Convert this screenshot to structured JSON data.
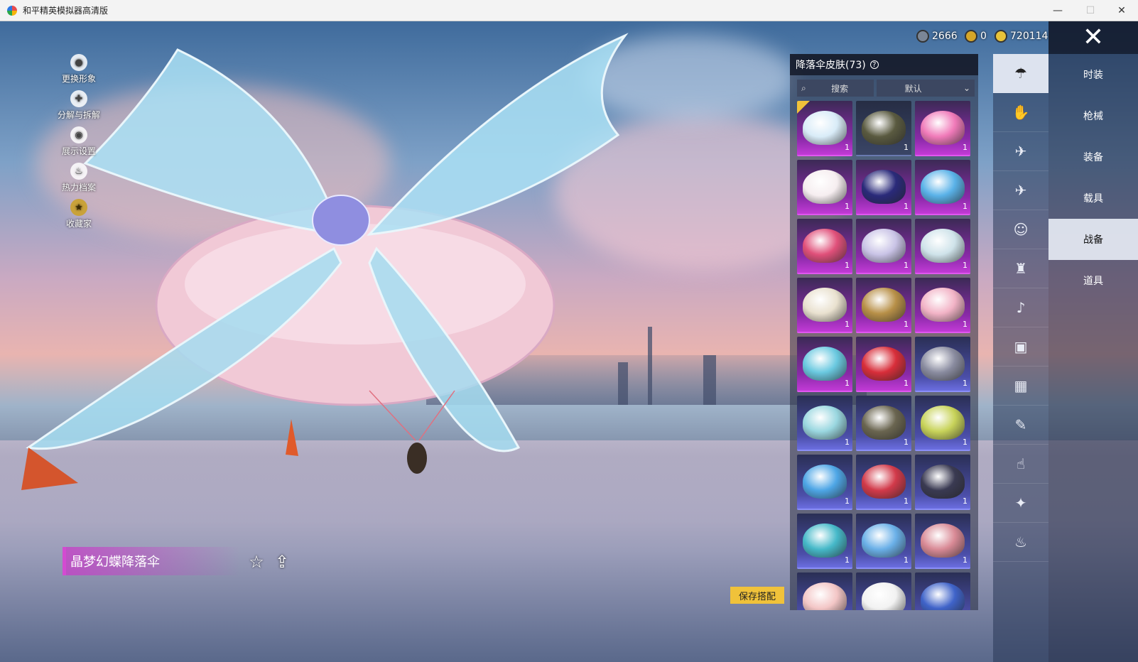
{
  "window": {
    "title": "和平精英模拟器高清版",
    "min_label": "—",
    "max_label": "☐",
    "close_label": "✕"
  },
  "left_menu": [
    {
      "label": "更换形象",
      "icon": "person-icon"
    },
    {
      "label": "分解与拆解",
      "icon": "dismantle-icon"
    },
    {
      "label": "展示设置",
      "icon": "eye-icon"
    },
    {
      "label": "热力档案",
      "icon": "flame-icon"
    },
    {
      "label": "收藏家",
      "icon": "collector-badge-icon"
    }
  ],
  "currency": [
    {
      "value": "2666",
      "icon": "coin-silver-icon",
      "color": "#7b8696"
    },
    {
      "value": "0",
      "icon": "coin-gold-a-icon",
      "color": "#d6a629"
    },
    {
      "value": "720114",
      "icon": "coin-gold-icon",
      "color": "#e8c33a"
    }
  ],
  "item": {
    "name": "晶梦幻蝶降落伞",
    "fav_icon": "☆",
    "share_icon": "⇪"
  },
  "save_button": "保存搭配",
  "panel": {
    "title": "降落伞皮肤(73)",
    "help_icon": "?",
    "search_label": "搜索",
    "search_icon": "⌕",
    "sort_label": "默认",
    "sort_icon": "⌄",
    "items": [
      {
        "count": "1",
        "rarity": "purple",
        "color": "#d9ecf8",
        "equipped": true
      },
      {
        "count": "1",
        "rarity": "dark",
        "color": "#5a5a40",
        "equipped": false
      },
      {
        "count": "1",
        "rarity": "purple",
        "color": "#f07ab9",
        "equipped": false
      },
      {
        "count": "1",
        "rarity": "purple",
        "color": "#f6eef0",
        "equipped": false
      },
      {
        "count": "1",
        "rarity": "purple",
        "color": "#2a2a7a",
        "equipped": false
      },
      {
        "count": "1",
        "rarity": "purple",
        "color": "#5ab2e8",
        "equipped": false
      },
      {
        "count": "1",
        "rarity": "purple",
        "color": "#e0507a",
        "equipped": false
      },
      {
        "count": "1",
        "rarity": "purple",
        "color": "#c9c3e6",
        "equipped": false
      },
      {
        "count": "1",
        "rarity": "purple",
        "color": "#cfe3ea",
        "equipped": false
      },
      {
        "count": "1",
        "rarity": "purple",
        "color": "#e9e1cf",
        "equipped": false
      },
      {
        "count": "1",
        "rarity": "purple",
        "color": "#b89048",
        "equipped": false
      },
      {
        "count": "1",
        "rarity": "purple",
        "color": "#f2b3c6",
        "equipped": false
      },
      {
        "count": "1",
        "rarity": "purple",
        "color": "#6ac9e0",
        "equipped": false
      },
      {
        "count": "1",
        "rarity": "purple",
        "color": "#d82e3a",
        "equipped": false
      },
      {
        "count": "1",
        "rarity": "blue",
        "color": "#8a8ca0",
        "equipped": false
      },
      {
        "count": "1",
        "rarity": "blue",
        "color": "#9ad7e0",
        "equipped": false
      },
      {
        "count": "1",
        "rarity": "blue",
        "color": "#6a6550",
        "equipped": false
      },
      {
        "count": "1",
        "rarity": "blue",
        "color": "#c8d35a",
        "equipped": false
      },
      {
        "count": "1",
        "rarity": "blue",
        "color": "#4ea6e6",
        "equipped": false
      },
      {
        "count": "1",
        "rarity": "blue",
        "color": "#d23a4a",
        "equipped": false
      },
      {
        "count": "1",
        "rarity": "blue",
        "color": "#3a3a52",
        "equipped": false
      },
      {
        "count": "1",
        "rarity": "blue",
        "color": "#46b9c9",
        "equipped": false
      },
      {
        "count": "1",
        "rarity": "blue",
        "color": "#6ab0e8",
        "equipped": false
      },
      {
        "count": "1",
        "rarity": "blue",
        "color": "#d98a96",
        "equipped": false
      },
      {
        "count": "",
        "rarity": "blue",
        "color": "#f3c6c6",
        "equipped": false
      },
      {
        "count": "",
        "rarity": "blue",
        "color": "#f2f2f2",
        "equipped": false
      },
      {
        "count": "",
        "rarity": "blue",
        "color": "#3f63c9",
        "equipped": false
      }
    ]
  },
  "icon_tabs": [
    {
      "icon": "parachute-icon",
      "glyph": "☂",
      "active": true
    },
    {
      "icon": "hand-icon",
      "glyph": "✋",
      "active": false
    },
    {
      "icon": "drone-icon",
      "glyph": "✈",
      "active": false
    },
    {
      "icon": "plane-icon",
      "glyph": "✈",
      "active": false
    },
    {
      "icon": "emote-face-icon",
      "glyph": "☺",
      "active": false
    },
    {
      "icon": "robot-icon",
      "glyph": "♜",
      "active": false
    },
    {
      "icon": "speaker-icon",
      "glyph": "♪",
      "active": false
    },
    {
      "icon": "chat-box-icon",
      "glyph": "▣",
      "active": false
    },
    {
      "icon": "picture-icon",
      "glyph": "▦",
      "active": false
    },
    {
      "icon": "spray-icon",
      "glyph": "✎",
      "active": false
    },
    {
      "icon": "gesture-icon",
      "glyph": "☝",
      "active": false
    },
    {
      "icon": "magic-wand-icon",
      "glyph": "✦",
      "active": false
    },
    {
      "icon": "food-icon",
      "glyph": "♨",
      "active": false
    }
  ],
  "categories": [
    {
      "label": "时装",
      "active": false
    },
    {
      "label": "枪械",
      "active": false
    },
    {
      "label": "装备",
      "active": false
    },
    {
      "label": "载具",
      "active": false
    },
    {
      "label": "战备",
      "active": true
    },
    {
      "label": "道具",
      "active": false
    }
  ],
  "close_icon": "✕"
}
